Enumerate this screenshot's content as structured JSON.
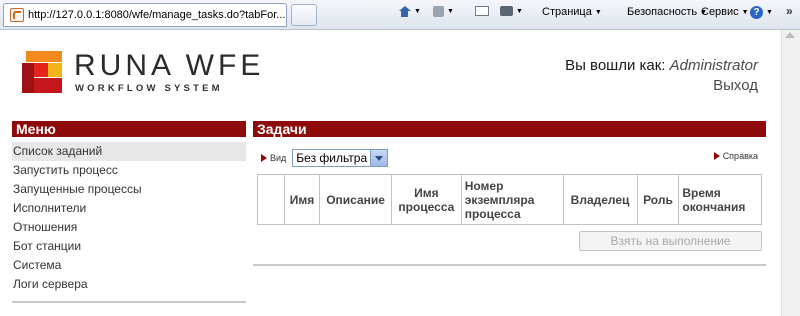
{
  "browser": {
    "tab_url": "http://127.0.0.1:8080/wfe/manage_tasks.do?tabFor...",
    "page_menu": "Страница",
    "security_menu": "Безопасность",
    "service_menu": "Сервис",
    "chevron": "»"
  },
  "header": {
    "logo_title": "RUNA WFE",
    "logo_subtitle": "WORKFLOW SYSTEM",
    "login_prefix": "Вы вошли как:",
    "login_user": "Administrator",
    "logout": "Выход"
  },
  "menu": {
    "title": "Меню",
    "items": [
      {
        "label": "Список заданий"
      },
      {
        "label": "Запустить процесс"
      },
      {
        "label": "Запущенные процессы"
      },
      {
        "label": "Исполнители"
      },
      {
        "label": "Отношения"
      },
      {
        "label": "Бот станции"
      },
      {
        "label": "Система"
      },
      {
        "label": "Логи сервера"
      }
    ]
  },
  "tasks": {
    "title": "Задачи",
    "view_label": "Вид",
    "filter_value": "Без фильтра",
    "help_label": "Справка",
    "columns": [
      "",
      "Имя",
      "Описание",
      "Имя процесса",
      "Номер экземпляра процесса",
      "Владелец",
      "Роль",
      "Время окончания"
    ],
    "take_button": "Взять на выполнение"
  }
}
